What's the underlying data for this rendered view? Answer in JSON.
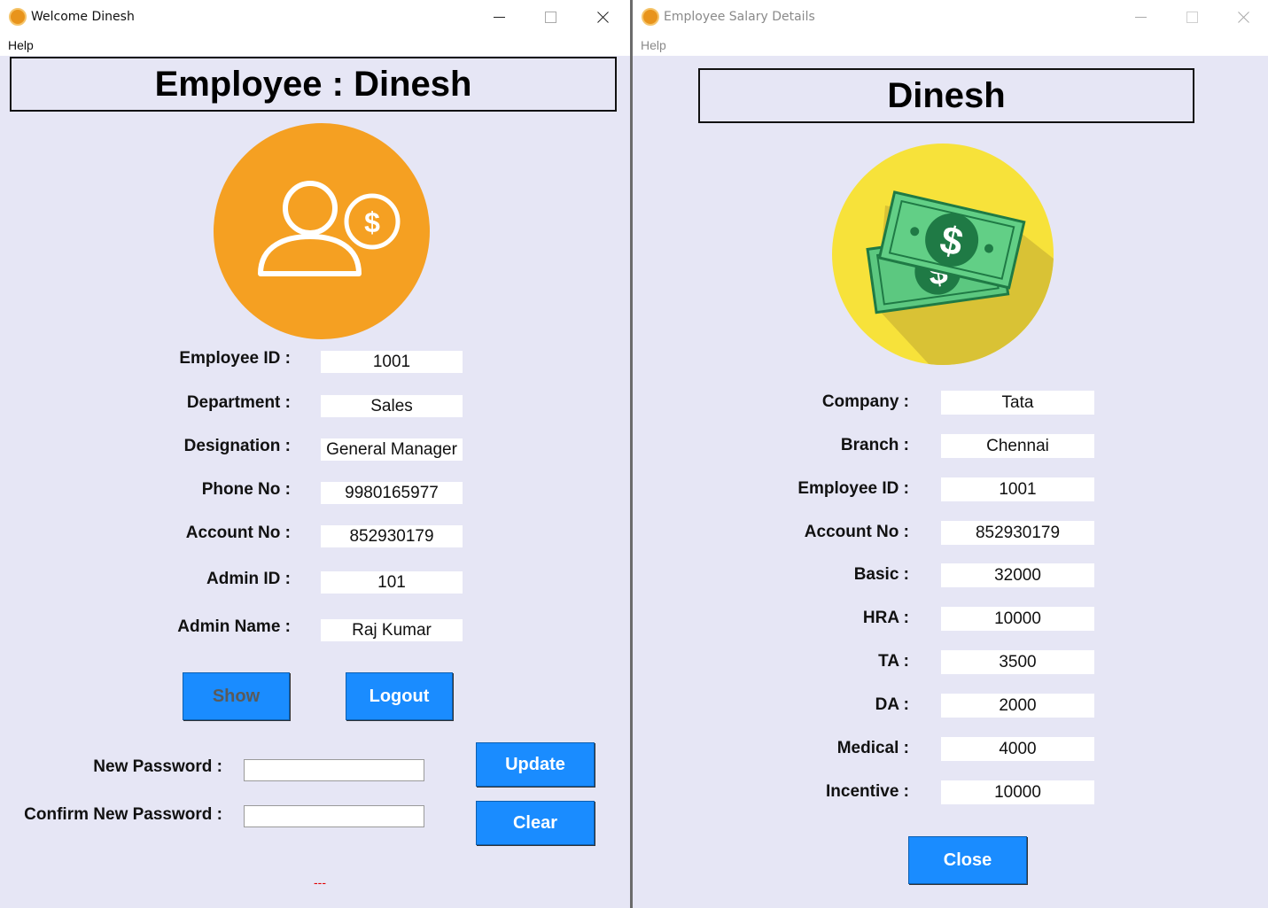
{
  "window1": {
    "title": "Welcome Dinesh",
    "menu_help": "Help",
    "heading": "Employee : Dinesh",
    "avatar_icon": "employee-salary-icon",
    "accent_color": "#f5a022",
    "fields": [
      {
        "label": "Employee ID :",
        "value": "1001"
      },
      {
        "label": "Department :",
        "value": "Sales"
      },
      {
        "label": "Designation :",
        "value": "General Manager"
      },
      {
        "label": "Phone No :",
        "value": "9980165977"
      },
      {
        "label": "Account No :",
        "value": "852930179"
      },
      {
        "label": "Admin ID :",
        "value": "101"
      },
      {
        "label": "Admin Name :",
        "value": "Raj Kumar"
      }
    ],
    "show_label": "Show",
    "logout_label": "Logout",
    "new_password_label": "New Password :",
    "confirm_password_label": "Confirm New Password :",
    "new_password_value": "",
    "confirm_password_value": "",
    "update_label": "Update",
    "clear_label": "Clear",
    "status_text": "---"
  },
  "window2": {
    "title": "Employee Salary Details",
    "menu_help": "Help",
    "heading": "Dinesh",
    "avatar_icon": "money-icon",
    "accent_color": "#f7e23a",
    "fields": [
      {
        "label": "Company :",
        "value": "Tata"
      },
      {
        "label": "Branch :",
        "value": "Chennai"
      },
      {
        "label": "Employee ID :",
        "value": "1001"
      },
      {
        "label": "Account No :",
        "value": "852930179"
      },
      {
        "label": "Basic :",
        "value": "32000"
      },
      {
        "label": "HRA :",
        "value": "10000"
      },
      {
        "label": "TA :",
        "value": "3500"
      },
      {
        "label": "DA :",
        "value": "2000"
      },
      {
        "label": "Medical :",
        "value": "4000"
      },
      {
        "label": "Incentive :",
        "value": "10000"
      }
    ],
    "close_label": "Close"
  },
  "colors": {
    "window_bg": "#e6e6f5",
    "button_blue": "#1a8cff",
    "status_red": "#e00000"
  }
}
